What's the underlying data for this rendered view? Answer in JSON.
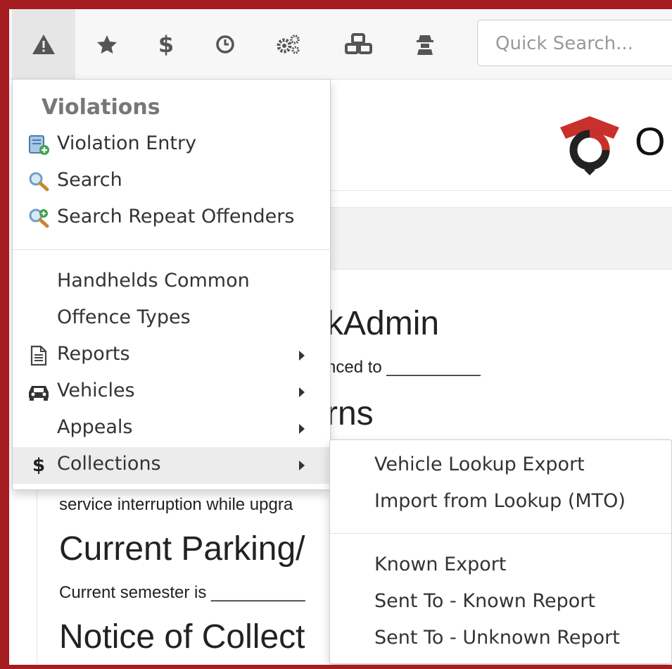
{
  "search": {
    "placeholder": "Quick Search..."
  },
  "page": {
    "brand_partial": "O",
    "heading_partial": "kAdmin",
    "reference_text": "nced to __________",
    "heading2_partial": "rns",
    "interruption_text": "service interruption while upgra",
    "parking_heading": "Current Parking/",
    "semester_text": "Current semester is __________",
    "notice_heading": "Notice of Collect"
  },
  "menu": {
    "header": "Violations",
    "items": [
      {
        "label": "Violation Entry",
        "icon": "violation-entry-icon"
      },
      {
        "label": "Search",
        "icon": "magnifier-icon"
      },
      {
        "label": "Search Repeat Offenders",
        "icon": "search-add-icon"
      },
      {
        "label": "Handhelds Common"
      },
      {
        "label": "Offence Types"
      },
      {
        "label": "Reports",
        "icon": "document-icon"
      },
      {
        "label": "Vehicles",
        "icon": "car-icon"
      },
      {
        "label": "Appeals"
      },
      {
        "label": "Collections",
        "icon": "dollar-icon"
      }
    ]
  },
  "submenu": {
    "items": [
      {
        "label": "Vehicle Lookup Export"
      },
      {
        "label": "Import from Lookup (MTO)"
      },
      {
        "label": "Known Export"
      },
      {
        "label": "Sent To - Known Report"
      },
      {
        "label": "Sent To - Unknown Report"
      }
    ]
  },
  "colors": {
    "frame": "#a51c21",
    "accent_red": "#c9302c",
    "hover": "#ececec"
  }
}
